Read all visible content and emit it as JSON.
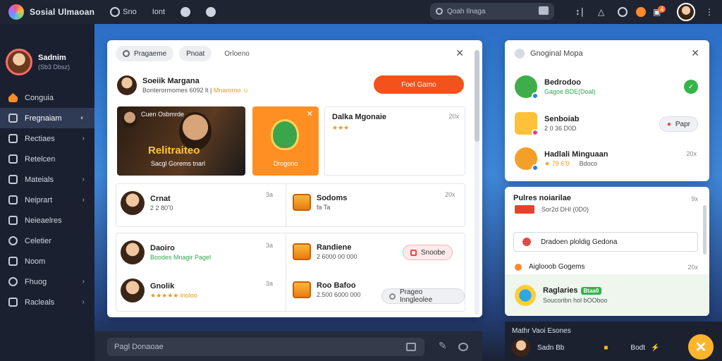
{
  "app": {
    "title": "Sosial Ulmaoan"
  },
  "topbar": {
    "items": [
      {
        "label": "Sno",
        "icon": "search-icon"
      },
      {
        "label": "Iont",
        "icon": ""
      },
      {
        "label": "",
        "icon": "shield-icon"
      },
      {
        "label": "",
        "icon": "clock-icon"
      }
    ],
    "search_placeholder": "Qoah Ilnaga",
    "notif_count": "4",
    "colors": {
      "bar": "#1e2432",
      "accent": "#f2521b"
    }
  },
  "sidebar": {
    "profile_name": "Sadnim",
    "profile_sub": "(Sb3 Dbsz)",
    "items": [
      {
        "label": "Conguia",
        "icon": "home-icon",
        "active": false,
        "chevron": false
      },
      {
        "label": "Fregnaiam",
        "icon": "store-icon",
        "active": true,
        "chevron": false
      },
      {
        "label": "Rectiaes",
        "icon": "grid-icon",
        "active": false,
        "chevron": true
      },
      {
        "label": "Retelcen",
        "icon": "people-icon",
        "active": false,
        "chevron": false
      },
      {
        "label": "Mateials",
        "icon": "chart-icon",
        "active": false,
        "chevron": true
      },
      {
        "label": "Neiprart",
        "icon": "bag-icon",
        "active": false,
        "chevron": true
      },
      {
        "label": "Neieaelres",
        "icon": "list-icon",
        "active": false,
        "chevron": false
      },
      {
        "label": "Celetier",
        "icon": "search-icon",
        "active": false,
        "chevron": false
      },
      {
        "label": "Noom",
        "icon": "calendar-icon",
        "active": false,
        "chevron": false
      },
      {
        "label": "Fhuog",
        "icon": "search-icon",
        "active": false,
        "chevron": true
      },
      {
        "label": "Racleals",
        "icon": "mail-icon",
        "active": false,
        "chevron": true
      }
    ]
  },
  "main": {
    "tabs": [
      "Pragaeme",
      "Pnoat",
      "Orloeno"
    ],
    "post": {
      "name": "Soeiik Margana",
      "sub": "Bonterormomes 6092 lt |",
      "sub_highlight": "Mnarorno",
      "button": "Foel Gamo"
    },
    "media": {
      "top_text": "Cuen Osbmrde",
      "title": "Relitraiteo",
      "sub": "Sacgl Gorems tnarl"
    },
    "game_tile": {
      "label": "Drogono"
    },
    "info_tile": {
      "title": "Dalka Mgonaie",
      "time": "20x",
      "sub": "★★★"
    },
    "rows": [
      {
        "title": "Crnat",
        "sub": "2 2 80̃ 0",
        "time": "3a",
        "type": "person"
      },
      {
        "title": "Sodoms",
        "sub": "fa Ta",
        "time": "20x",
        "type": "chest"
      },
      {
        "title": "Daoiro",
        "sub": "Boodes Mnagir Pagel",
        "time": "3a",
        "type": "person"
      },
      {
        "title": "Randiene",
        "sub": "2 6000 00 000",
        "time": "",
        "type": "chest",
        "button": "Snoobe"
      },
      {
        "title": "Gnolik",
        "sub": "★★★★★ lnoloo",
        "time": "3a",
        "type": "person"
      },
      {
        "title": "Roo Bafoo",
        "sub": "2.500 6000 000",
        "time": "",
        "type": "chest",
        "button": "Prageo Inngleolee"
      }
    ]
  },
  "right1": {
    "title": "Gnoginal Mopa",
    "items": [
      {
        "title": "Bedrodoo",
        "sub": "Gagoe BDE(Doal)",
        "action": "check"
      },
      {
        "title": "Senboiab",
        "sub": "2 0 36 D0D",
        "action": "Papr"
      },
      {
        "title": "Hadlali Minguaan",
        "sub": "★ 79 6̃ 0",
        "extra": "Bdoco",
        "time": "20x"
      }
    ]
  },
  "right2": {
    "title": "Pulres noiarilae",
    "time": "9x",
    "line": "Sor2d DHI (0D0)",
    "field": "Dradoen ploldig Gedona",
    "section": "Aiglooob Gogems",
    "section_time": "20x",
    "bottom_title": "Raglaries",
    "bottom_badge": "Btaa0",
    "bottom_sub": "Soucoribn hol bOOboo"
  },
  "composer": {
    "placeholder": "Pagl Donaoae"
  },
  "dock": {
    "title": "Mathr Vaoi Esones",
    "name": "Sadn Bb",
    "extra": "Bodt"
  }
}
